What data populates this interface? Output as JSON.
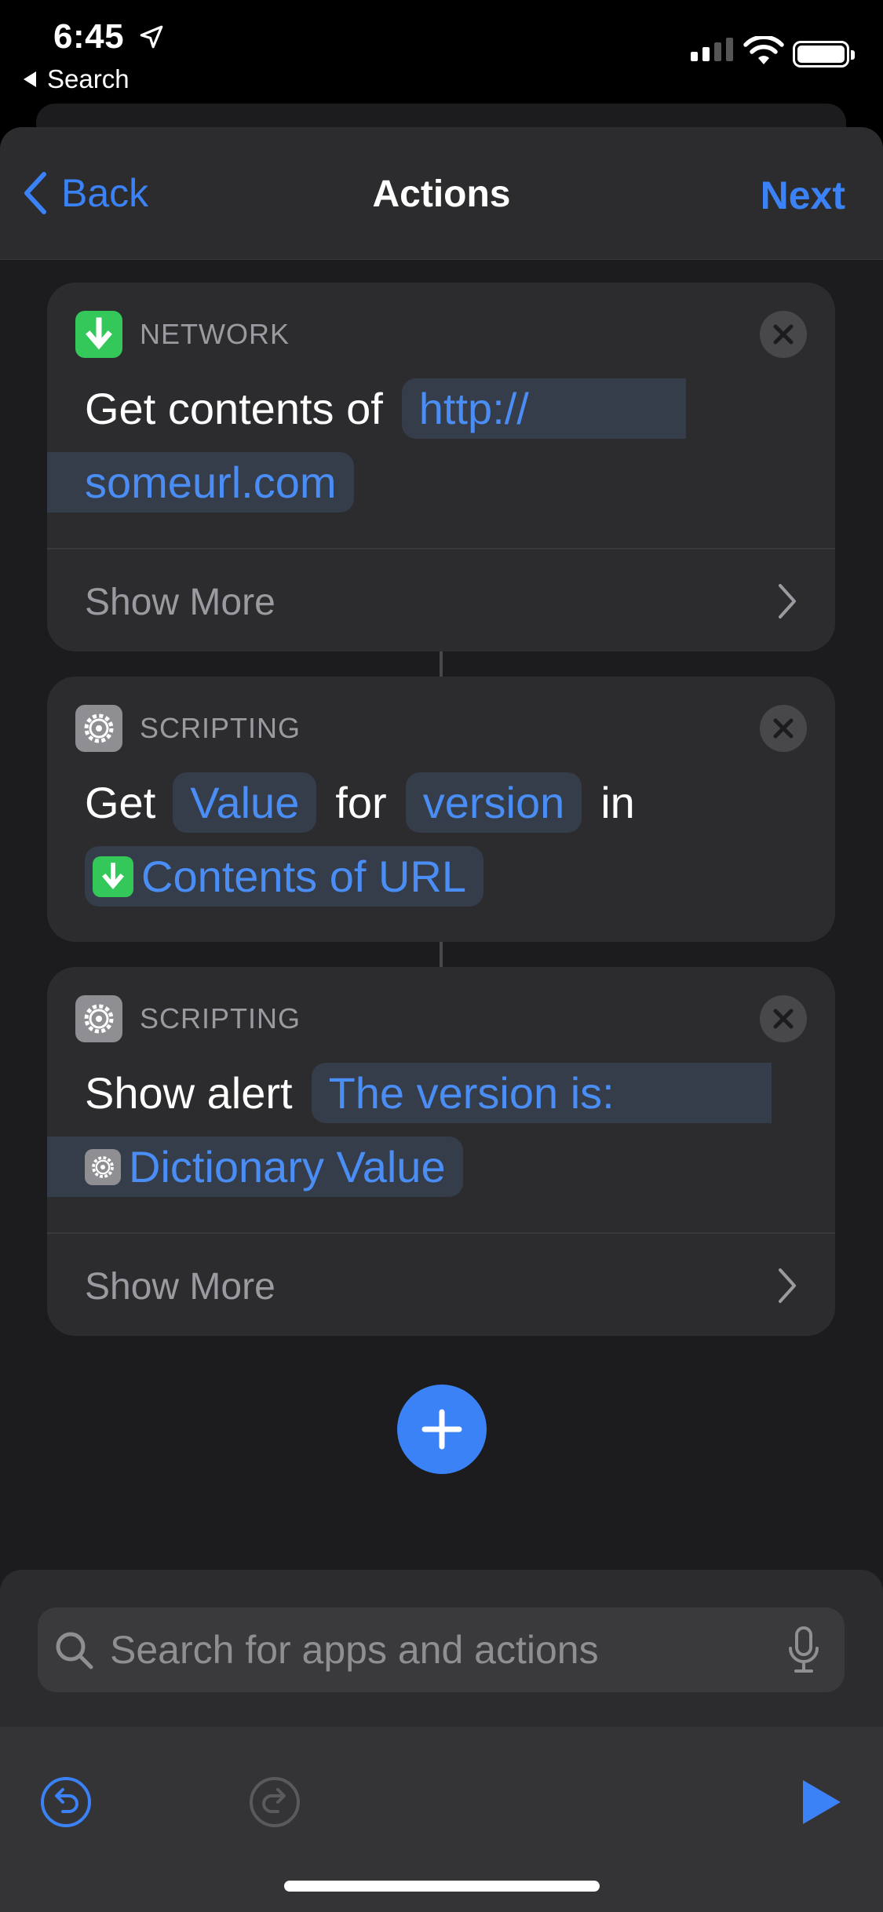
{
  "status_bar": {
    "time": "6:45",
    "back_app": "Search"
  },
  "nav": {
    "back_label": "Back",
    "title": "Actions",
    "next_label": "Next"
  },
  "actions": [
    {
      "category": "NETWORK",
      "verb": "Get contents of",
      "url_line1": "http://",
      "url_line2": "someurl.com",
      "show_more": "Show More"
    },
    {
      "category": "SCRIPTING",
      "w_get": "Get",
      "value_token": "Value",
      "w_for": "for",
      "key_token": "version",
      "w_in": "in",
      "source_token": "Contents of URL"
    },
    {
      "category": "SCRIPTING",
      "verb": "Show alert",
      "msg_line1": "The version is:",
      "msg_line2": "Dictionary Value",
      "show_more": "Show More"
    }
  ],
  "search": {
    "placeholder": "Search for apps and actions"
  },
  "colors": {
    "accent": "#3b82f6",
    "network_icon": "#34c759",
    "scripting_icon": "#8e8e93"
  }
}
